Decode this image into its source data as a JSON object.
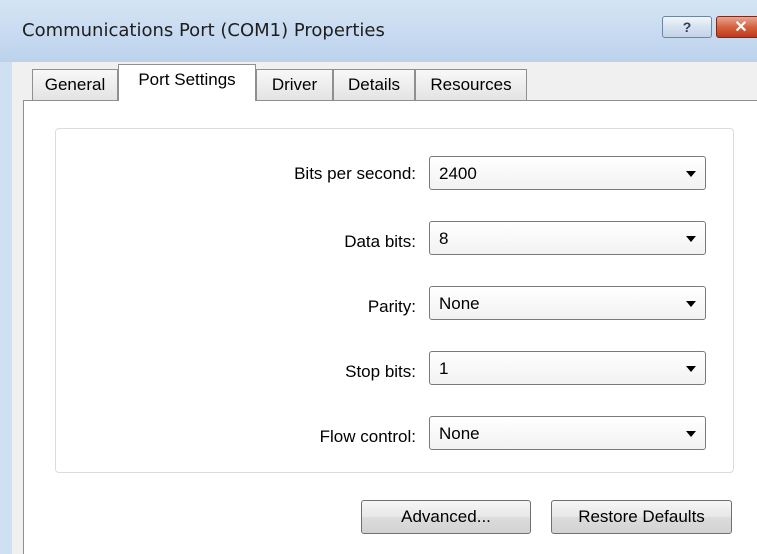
{
  "window": {
    "title": "Communications Port (COM1) Properties",
    "help_label": "?",
    "close_label": "✕"
  },
  "tabs": [
    {
      "label": "General"
    },
    {
      "label": "Port Settings"
    },
    {
      "label": "Driver"
    },
    {
      "label": "Details"
    },
    {
      "label": "Resources"
    }
  ],
  "active_tab": "Port Settings",
  "settings": {
    "bits_per_second": {
      "label": "Bits per second:",
      "value": "2400"
    },
    "data_bits": {
      "label": "Data bits:",
      "value": "8"
    },
    "parity": {
      "label": "Parity:",
      "value": "None"
    },
    "stop_bits": {
      "label": "Stop bits:",
      "value": "1"
    },
    "flow_control": {
      "label": "Flow control:",
      "value": "None"
    }
  },
  "buttons": {
    "advanced": "Advanced...",
    "restore_defaults": "Restore Defaults"
  },
  "icons": {
    "help": "question-mark-icon",
    "close": "close-icon",
    "dropdown": "chevron-down-icon"
  }
}
